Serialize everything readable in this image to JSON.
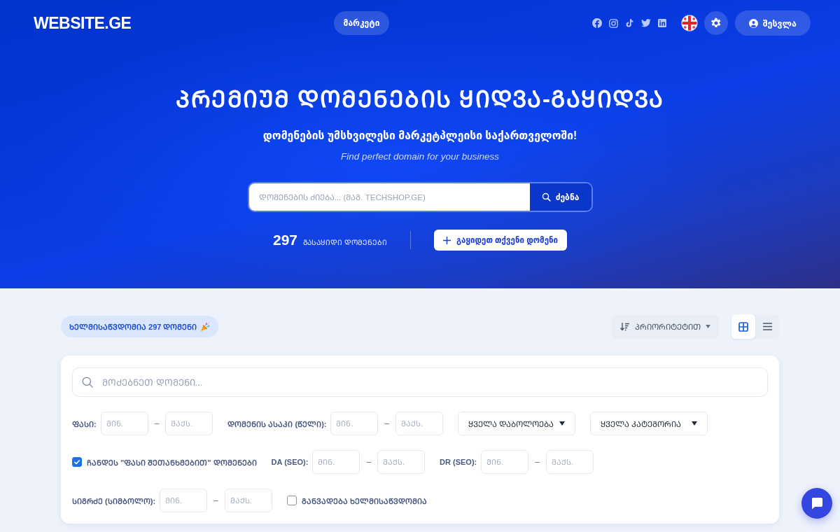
{
  "header": {
    "logo": "WEBSITE.GE",
    "nav": [
      {
        "label": "მარკეტი"
      }
    ],
    "login": {
      "label": "შესვლა"
    }
  },
  "hero": {
    "title": "ᲞᲠᲔᲛᲘᲣᲛ ᲓᲝᲛᲔᲜᲔᲑᲘᲡ ᲧᲘᲓᲕᲐ-ᲒᲐᲧᲘᲓᲕᲐ",
    "subtitle": "დომენების უმსხვილესი მარკეტპლეისი საქართველოში!",
    "tagline": "Find perfect domain for your business",
    "search": {
      "placeholder": "ᲓᲝᲛᲔᲜᲔᲑᲘᲡ ᲫᲘᲔᲑᲐ... (ᲛᲐᲒ. TECHSHOP.GE)",
      "button": "ძებნა"
    },
    "stats": {
      "count": "297",
      "label": "ᲒᲐᲡᲐᲧᲘᲓᲘ ᲓᲝᲛᲔᲜᲔᲑᲘ"
    },
    "sell_button": "გაყიდეთ თქვენი დომენი"
  },
  "toolbar": {
    "badge": "ᲮᲔᲚᲛᲘᲡᲐᲬᲕᲓᲝᲛᲘᲐ 297 ᲓᲝᲛᲔᲜᲘ",
    "sort": "ᲞᲠᲘᲝᲠᲘᲢᲔᲢᲘᲗ",
    "view_modes": [
      {
        "kind": "grid",
        "selected": true
      },
      {
        "kind": "list",
        "selected": false
      }
    ]
  },
  "filters": {
    "search": {
      "placeholder": "ᲛᲝᲫᲔᲑᲜᲔᲗ ᲓᲝᲛᲔᲜᲘ..."
    },
    "rows": [
      [
        {
          "kind": "range",
          "label": "ᲤᲐᲡᲘ:",
          "min_placeholder": "ᲛᲘᲜ.",
          "separator": "–",
          "max_placeholder": "ᲛᲐᲥᲡ."
        },
        {
          "kind": "range",
          "label": "ᲓᲝᲛᲔᲜᲘᲡ ᲐᲡᲐᲙᲘ (ᲬᲔᲚᲘ):",
          "min_placeholder": "ᲛᲘᲜ.",
          "separator": "–",
          "max_placeholder": "ᲛᲐᲥᲡ."
        },
        {
          "kind": "select",
          "value": "ᲧᲕᲔᲚᲐ ᲓᲐᲑᲝᲚᲝᲔᲑᲐ"
        },
        {
          "kind": "select",
          "value": "ᲧᲕᲔᲚᲐ ᲙᲐᲢᲔᲒᲝᲠᲘᲐ"
        }
      ],
      [
        {
          "kind": "checkbox",
          "label": "ᲩᲐᲜᲓᲔᲡ \"ᲤᲐᲡᲘ ᲨᲔᲗᲐᲜᲮᲛᲔᲑᲘᲗ\" ᲓᲝᲛᲔᲜᲔᲑᲘ",
          "checked": true
        },
        {
          "kind": "range",
          "label": "DA (SEO):",
          "min_placeholder": "ᲛᲘᲜ.",
          "separator": "–",
          "max_placeholder": "ᲛᲐᲥᲡ."
        },
        {
          "kind": "range",
          "label": "DR (SEO):",
          "min_placeholder": "ᲛᲘᲜ.",
          "separator": "–",
          "max_placeholder": "ᲛᲐᲥᲡ."
        }
      ],
      [
        {
          "kind": "range",
          "label": "ᲡᲘᲒᲠᲫᲔ (ᲡᲘᲛᲑᲝᲚᲝ):",
          "min_placeholder": "ᲛᲘᲜ.",
          "separator": "–",
          "max_placeholder": "ᲛᲐᲥᲡ."
        },
        {
          "kind": "checkbox",
          "label": "ᲒᲐᲜᲕᲐᲓᲔᲑᲐ ᲮᲔᲚᲛᲘᲡᲐᲬᲕᲓᲝᲛᲘᲐ",
          "checked": false
        }
      ]
    ]
  }
}
